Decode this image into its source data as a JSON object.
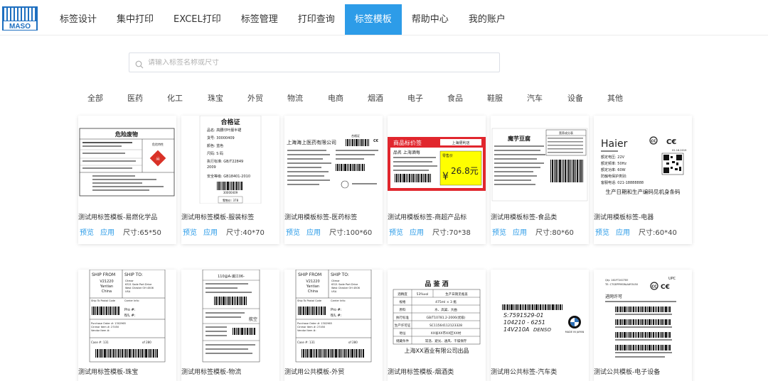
{
  "brand": {
    "logo_text": "MASO"
  },
  "nav": [
    {
      "label": "标签设计"
    },
    {
      "label": "集中打印"
    },
    {
      "label": "EXCEL打印"
    },
    {
      "label": "标签管理"
    },
    {
      "label": "打印查询"
    },
    {
      "label": "标签模板",
      "active": true
    },
    {
      "label": "帮助中心"
    },
    {
      "label": "我的账户"
    }
  ],
  "search": {
    "placeholder": "请输入标签名称或尺寸",
    "value": "",
    "icon": "search-icon"
  },
  "categories": [
    "全部",
    "医药",
    "化工",
    "珠宝",
    "外贸",
    "物流",
    "电商",
    "烟酒",
    "电子",
    "食品",
    "鞋服",
    "汽车",
    "设备",
    "其他"
  ],
  "actions": {
    "preview": "预览",
    "apply": "应用",
    "size_prefix": "尺寸:"
  },
  "templates": [
    {
      "title": "测试用标签模板-易燃化学品",
      "size": "65*50"
    },
    {
      "title": "测试用标签模板-服装标签",
      "size": "40*70"
    },
    {
      "title": "测试用模板标签-医药标签",
      "size": "100*60"
    },
    {
      "title": "测试用模板标签-商超产品标",
      "size": "70*38"
    },
    {
      "title": "测试用模板标签-食品类",
      "size": "80*60"
    },
    {
      "title": "测试用模板标签-电器",
      "size": "60*40"
    },
    {
      "title": "测试用标签模板-珠宝"
    },
    {
      "title": "测试用标签模板-物流"
    },
    {
      "title": "测试用公共模板-外贸"
    },
    {
      "title": "测试用标签模板-烟酒类"
    },
    {
      "title": "测试用公共标签-汽车类"
    },
    {
      "title": "测试公共模板-电子设备"
    }
  ],
  "thumbs": {
    "hazard": {
      "title": "危险废物",
      "label": "危险特性"
    },
    "garment": {
      "title": "合格证",
      "lines": [
        "品名: 高腰印叶服半裙",
        "货号: 30000409",
        "颜色: 蓝色",
        "尺码: S 码",
        "执行标准: GB/T22849",
        "2009",
        "安全等级: GB18401-2010"
      ],
      "number": "30000409",
      "price": "零售价: 378"
    },
    "pharma": {
      "company": "上海海上医药有限公司",
      "cert": "合格证"
    },
    "retail": {
      "header": "商品标价签",
      "shop": "上海便利店",
      "name": "品名 上海酒每",
      "price_label": "零售价",
      "currency": "¥",
      "price": "26.8元"
    },
    "food": {
      "name": "魔芋豆腐",
      "table_title": "营养成分表"
    },
    "appliance": {
      "brand": "Haier",
      "date": "02-16-2019",
      "lines": [
        "额定电压: 22V",
        "额定频率: 50Hz",
        "额定功率: 60W",
        "防触电保护类别:",
        "客服电话: 021-18888888"
      ],
      "footer": "生产日期和生产编码见机身条码"
    },
    "ship": {
      "from_label": "SHIP FROM",
      "to_label": "SHIP TO:",
      "from_code": "V21220",
      "from_city": "Yantian",
      "from_country": "China",
      "to_lines": [
        "Citmar",
        "6321 Sade Port Drive",
        "West Chester OH 4506",
        "USA"
      ],
      "postal": "Ship To Postal Code",
      "carrier": "Carrier Info:",
      "pro": "Pro #:",
      "bl": "B/L #:",
      "po": "Purchase Order #: 1302965",
      "cinmar": "Cinmar Item #: 27450",
      "vendor": "Vendor Item #:",
      "case": "Case #: 131",
      "of": "of 280"
    },
    "logistics": {
      "top": "110@A-浦江06-",
      "dest": "航空"
    },
    "liquor": {
      "title": "品 鉴 酒",
      "rows": [
        [
          "酒精度",
          "53%vol",
          "生产日期见瓶盖"
        ],
        [
          "规格",
          "475ml × 3 瓶"
        ],
        [
          "原料",
          "水、高粱、大曲"
        ],
        [
          "执行标准",
          "GB/T10781.2-2006(优级)"
        ],
        [
          "生产许可证",
          "SC11564112123328"
        ],
        [
          "地址",
          "XX省XX市XX区XX村"
        ],
        [
          "储藏条件",
          "常温、避光、通风、干燥保存"
        ]
      ],
      "footer": "上海XX酒业有限公司出品"
    },
    "auto": {
      "code1": "S:7591529-01",
      "code2": "104210 - 6251",
      "code3": "14V210A",
      "maker": "DENSO",
      "origin": "MADE IN JAPAN"
    },
    "electronics": {
      "upc": "UPC",
      "lines": [
        "Qty: 161FT20CTEE",
        "TE: CTGEPPMSRAA6Y3450"
      ],
      "permit": "进网许可"
    }
  }
}
